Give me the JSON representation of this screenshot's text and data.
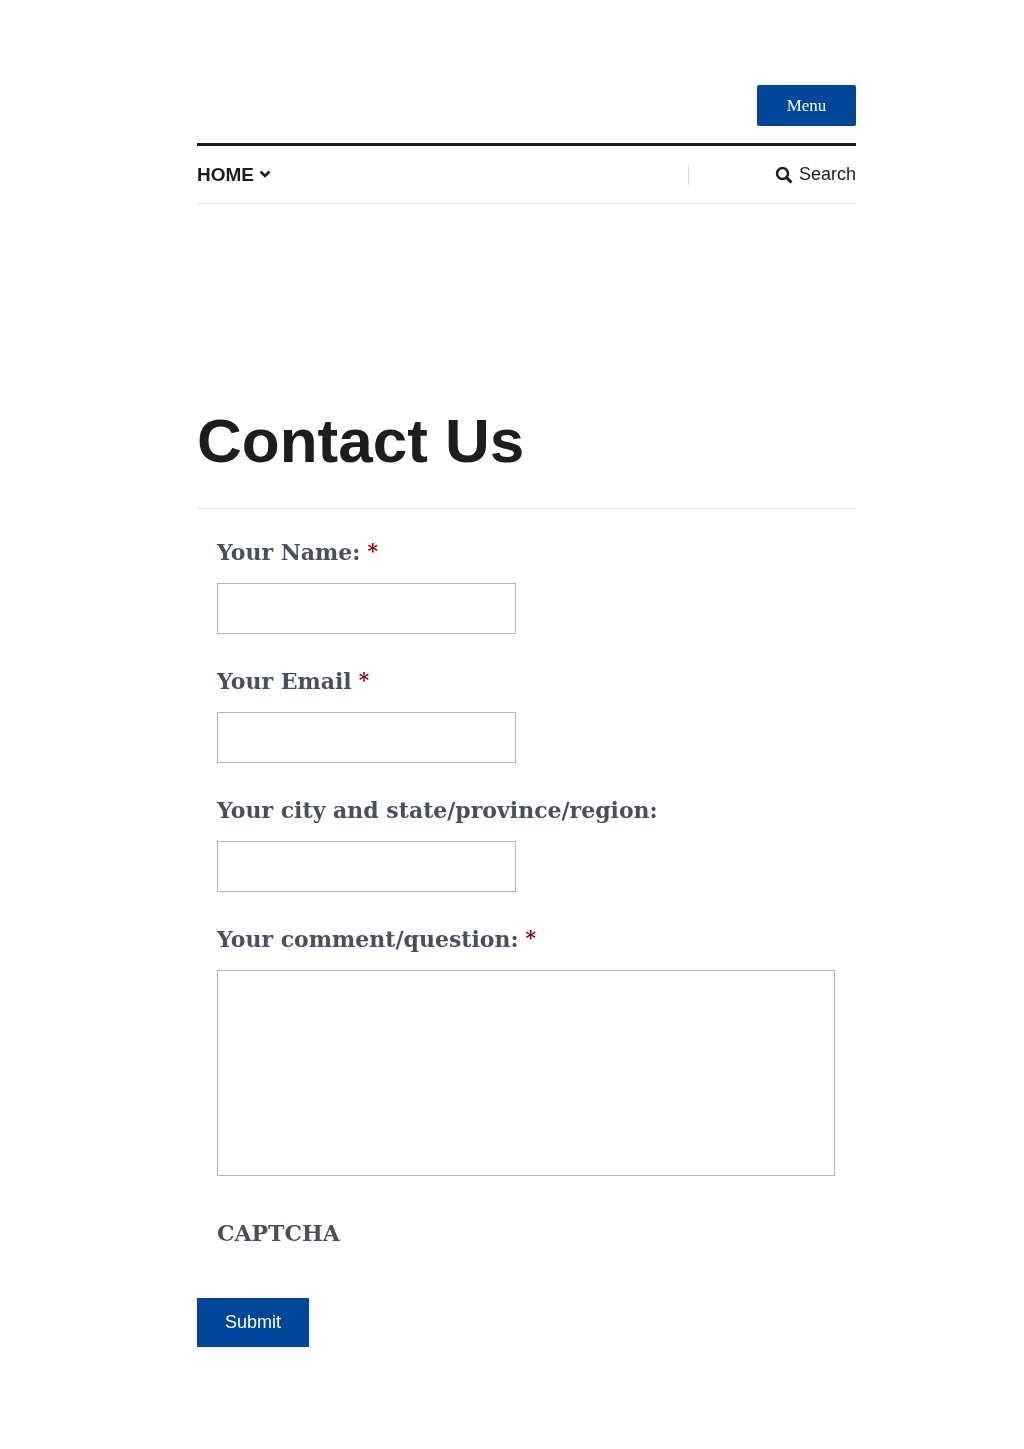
{
  "header": {
    "menu_button": "Menu"
  },
  "nav": {
    "home": "HOME",
    "search": "Search"
  },
  "title": "Contact Us",
  "form": {
    "fields": [
      {
        "label": "Your Name:",
        "required": true,
        "kind": "input"
      },
      {
        "label": "Your Email",
        "required": true,
        "kind": "input"
      },
      {
        "label": "Your city and state/province/region:",
        "required": false,
        "kind": "input"
      },
      {
        "label": "Your comment/question:",
        "required": true,
        "kind": "textarea"
      }
    ],
    "required_mark": "*",
    "captcha": "CAPTCHA",
    "submit": "Submit"
  }
}
